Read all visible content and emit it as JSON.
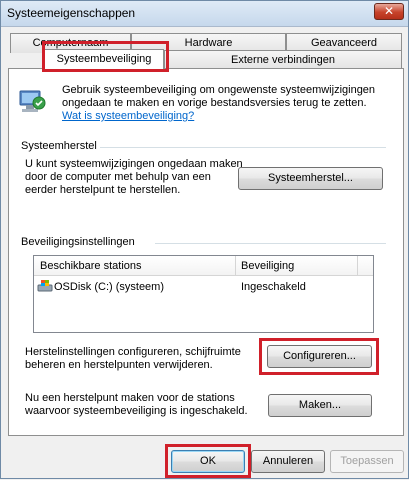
{
  "window": {
    "title": "Systeemeigenschappen",
    "close_glyph": "✕"
  },
  "tabs": {
    "row_back": [
      "Computernaam",
      "Hardware",
      "Geavanceerd"
    ],
    "row_front": [
      "Systeembeveiliging",
      "Externe verbindingen"
    ],
    "active": "Systeembeveiliging"
  },
  "intro": {
    "text_line1": "Gebruik systeembeveiliging om ongewenste systeemwijzigingen",
    "text_line2": "ongedaan te maken en vorige bestandsversies terug te zetten.",
    "link": "Wat is systeembeveiliging?"
  },
  "restore": {
    "heading": "Systeemherstel",
    "text_line1": "U kunt systeemwijzigingen ongedaan maken",
    "text_line2": "door de computer met behulp van een",
    "text_line3": "eerder herstelpunt te herstellen.",
    "button": "Systeemherstel..."
  },
  "protection": {
    "heading": "Beveiligingsinstellingen",
    "columns": [
      "Beschikbare stations",
      "Beveiliging"
    ],
    "rows": [
      {
        "drive": "OSDisk (C:) (systeem)",
        "status": "Ingeschakeld"
      }
    ],
    "configure_text_line1": "Herstelinstellingen configureren, schijfruimte",
    "configure_text_line2": "beheren en herstelpunten verwijderen.",
    "configure_button": "Configureren...",
    "create_text_line1": "Nu een herstelpunt maken voor de stations",
    "create_text_line2": "waarvoor systeembeveiliging is ingeschakeld.",
    "create_button": "Maken..."
  },
  "footer": {
    "ok": "OK",
    "cancel": "Annuleren",
    "apply": "Toepassen"
  },
  "colors": {
    "highlight": "#d0202a",
    "link": "#0066cc"
  }
}
